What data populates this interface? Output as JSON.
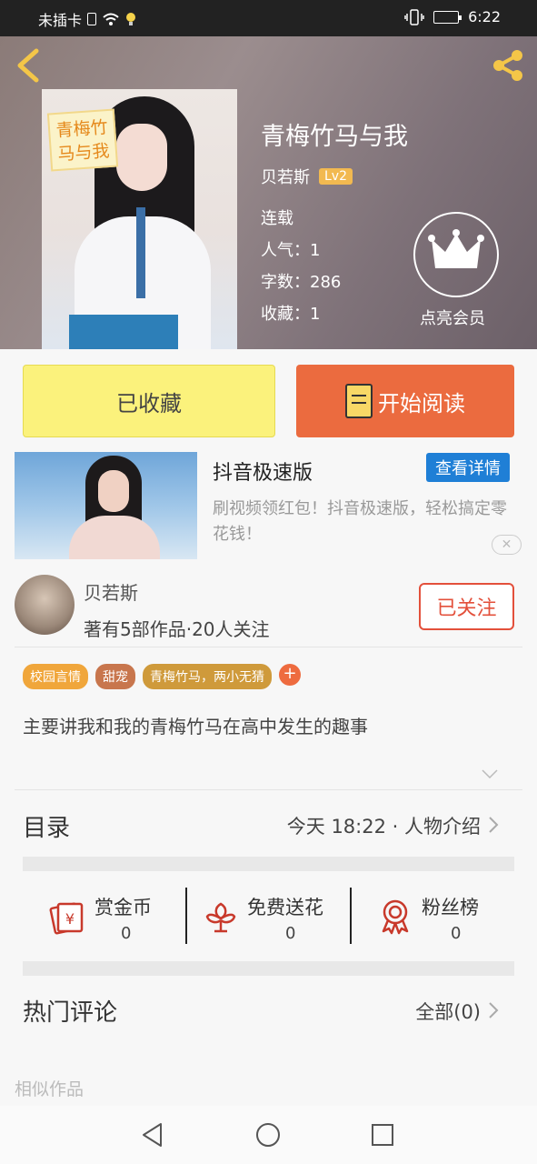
{
  "status_bar": {
    "carrier": "未插卡",
    "time": "6:22"
  },
  "book": {
    "cover_label": "青梅竹马与我",
    "title": "青梅竹马与我",
    "author": "贝若斯",
    "level": "Lv2",
    "status": "连载",
    "popularity": "人气：1",
    "word_count": "字数：286",
    "favorites": "收藏：1"
  },
  "vip_label": "点亮会员",
  "actions": {
    "favorited": "已收藏",
    "start_reading": "开始阅读"
  },
  "ad": {
    "title": "抖音极速版",
    "button": "查看详情",
    "description": "刷视频领红包！抖音极速版，轻松搞定零花钱！"
  },
  "author_card": {
    "name": "贝若斯",
    "stats": "著有5部作品·20人关注",
    "follow_button": "已关注"
  },
  "tags": [
    {
      "label": "校园言情",
      "color": "#f0a63b"
    },
    {
      "label": "甜宠",
      "color": "#c8764d"
    },
    {
      "label": "青梅竹马，两小无猜",
      "color": "#cf9a3b"
    }
  ],
  "synopsis": "主要讲我和我的青梅竹马在高中发生的趣事",
  "toc": {
    "label": "目录",
    "latest": "今天 18:22 · 人物介绍"
  },
  "rewards": [
    {
      "label": "赏金币",
      "value": "0"
    },
    {
      "label": "免费送花",
      "value": "0"
    },
    {
      "label": "粉丝榜",
      "value": "0"
    }
  ],
  "comments": {
    "label": "热门评论",
    "all": "全部(0)"
  },
  "similar_label": "相似作品",
  "colors": {
    "accent": "#eb6b3f",
    "favorite_bg": "#fbf27c",
    "follow": "#e3503b",
    "ad_button": "#1f7fd6",
    "reward_icon": "#c8392b"
  }
}
